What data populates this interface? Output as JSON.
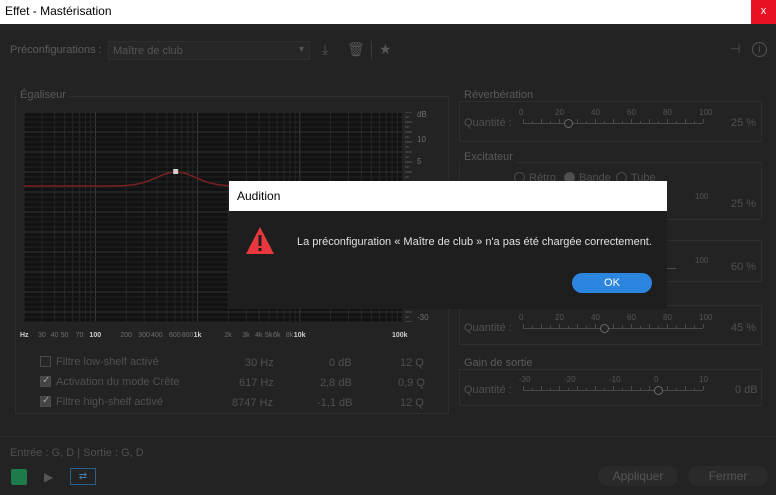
{
  "window": {
    "title": "Effet - Mastérisation",
    "close_label": "x"
  },
  "toolbar": {
    "preset_label": "Préconfigurations :",
    "preset_value": "Maître de club",
    "icons": [
      "download-icon",
      "trash-icon",
      "star-icon",
      "routing-icon",
      "info-icon"
    ]
  },
  "eq": {
    "title": "Égaliseur",
    "x_ticks": [
      "Hz",
      "30",
      "40",
      "50",
      "70",
      "100",
      "200",
      "300",
      "400",
      "600",
      "800",
      "1k",
      "2k",
      "3k",
      "4k",
      "5k",
      "6k",
      "8k",
      "10k",
      "100k"
    ],
    "y_ticks": [
      "dB",
      "10",
      "5",
      "-30"
    ],
    "rows": [
      {
        "label": "Filtre low-shelf activé",
        "checked": false,
        "freq": "30 Hz",
        "gain": "0 dB",
        "q": "12 Q"
      },
      {
        "label": "Activation du mode Crête",
        "checked": true,
        "freq": "617 Hz",
        "gain": "2,8 dB",
        "q": "0,9 Q"
      },
      {
        "label": "Filtre high-shelf activé",
        "checked": true,
        "freq": "8747 Hz",
        "gain": "-1,1 dB",
        "q": "12 Q"
      }
    ]
  },
  "reverb": {
    "title": "Réverbération",
    "qty_label": "Quantité :",
    "value": "25 %",
    "level": 25,
    "ticks": [
      "0",
      "20",
      "40",
      "60",
      "80",
      "100"
    ]
  },
  "exciter": {
    "title": "Excitateur",
    "modes": [
      "Rétro",
      "Bande",
      "Tube"
    ],
    "selected": "Bande",
    "value": "25 %",
    "level": 25,
    "ticks_visible": [
      "100"
    ]
  },
  "hidden1": {
    "value": "60 %",
    "level": 60,
    "ticks_visible": [
      "100"
    ]
  },
  "hidden2": {
    "qty_label": "Quantité :",
    "value": "45 %",
    "level": 45,
    "ticks": [
      "0",
      "20",
      "40",
      "60",
      "80",
      "100"
    ]
  },
  "output": {
    "title": "Gain de sortie",
    "qty_label": "Quantité :",
    "value": "0 dB",
    "level": 0,
    "ticks": [
      "-30",
      "-20",
      "-10",
      "0",
      "10"
    ]
  },
  "footer": {
    "io_label": "Entrée : G, D | Sortie : G, D",
    "apply_label": "Appliquer",
    "close_label": "Fermer"
  },
  "dialog": {
    "title": "Audition",
    "message": "La préconfiguration « Maître de club » n'a pas été chargée correctement.",
    "ok_label": "OK",
    "icon": "warning-icon"
  },
  "colors": {
    "accent": "#2c86e0",
    "warning": "#e8383d",
    "curve": "#7a2020"
  }
}
